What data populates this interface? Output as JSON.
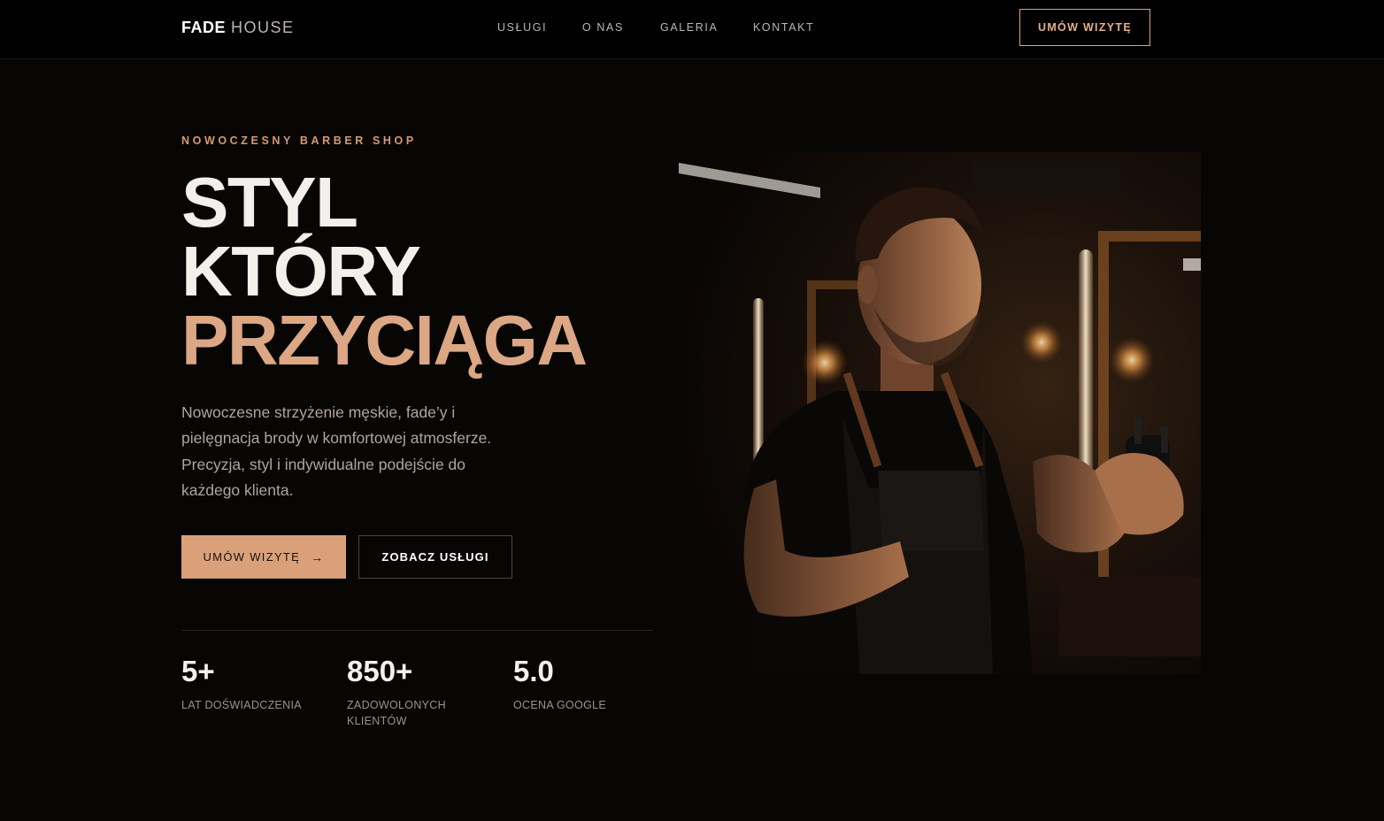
{
  "brand": {
    "name_strong": "FADE",
    "name_light": "HOUSE"
  },
  "nav": {
    "links": [
      {
        "label": "USŁUGI"
      },
      {
        "label": "O NAS"
      },
      {
        "label": "GALERIA"
      },
      {
        "label": "KONTAKT"
      }
    ],
    "cta_label": "UMÓW WIZYTĘ"
  },
  "hero": {
    "eyebrow": "NOWOCZESNY BARBER SHOP",
    "headline": [
      "STYL",
      "KTÓRY",
      "PRZYCIĄGA"
    ],
    "description": "Nowoczesne strzyżenie męskie, fade’y i pielęgnacja brody w komfortowej atmosferze. Precyzja, styl i indywidualne podejście do każdego klienta.",
    "primary_button": {
      "label": "UMÓW WIZYTĘ",
      "icon": "arrow-right-icon"
    },
    "secondary_button": {
      "label": "ZOBACZ USŁUGI"
    },
    "stats": [
      {
        "value": "5+",
        "label": "LAT DOŚWIADCZENIA"
      },
      {
        "value": "850+",
        "label": "ZADOWOLONYCH KLIENTÓW"
      },
      {
        "value": "5.0",
        "label": "OCENA GOOGLE"
      }
    ]
  },
  "colors": {
    "background": "#080605",
    "navbar": "#000000",
    "accent": "#d9a07a",
    "text": "#f3efeb",
    "muted_text": "#aea59e"
  }
}
